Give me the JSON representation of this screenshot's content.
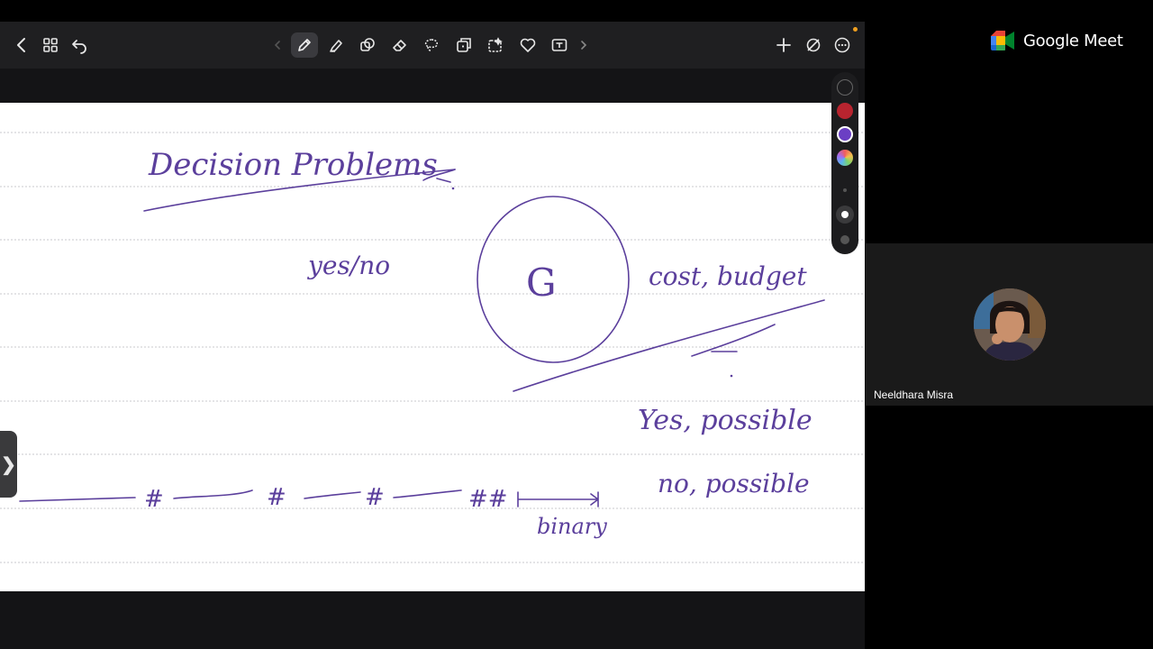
{
  "toolbar": {
    "left_buttons": [
      "back-icon",
      "grid-icon",
      "undo-icon"
    ],
    "tools": [
      "pen-icon",
      "highlighter-icon",
      "shapes-icon",
      "eraser-icon",
      "lasso-icon",
      "image-icon",
      "screenshot-icon",
      "favorite-icon",
      "text-icon"
    ],
    "active_tool": "pen-icon",
    "right_buttons": [
      "add-page-icon",
      "hide-icon",
      "more-icon"
    ]
  },
  "palette": {
    "colors": [
      "#1c1c1e",
      "#b8242f",
      "#6b3fc4",
      "rainbow"
    ],
    "selected_color": "#6b3fc4"
  },
  "handwriting": {
    "heading": "Decision Problems",
    "yes_no": "yes/no",
    "graph_label": "G",
    "cost": "cost, budget",
    "yes_possible": "Yes, possible",
    "no_possible": "no, possible",
    "binary": "binary",
    "hash": "#",
    "double_hash": "##",
    "ink_color": "#5b3f9c"
  },
  "meet": {
    "brand": "Google Meet",
    "participant_name": "Neeldhara Misra"
  }
}
